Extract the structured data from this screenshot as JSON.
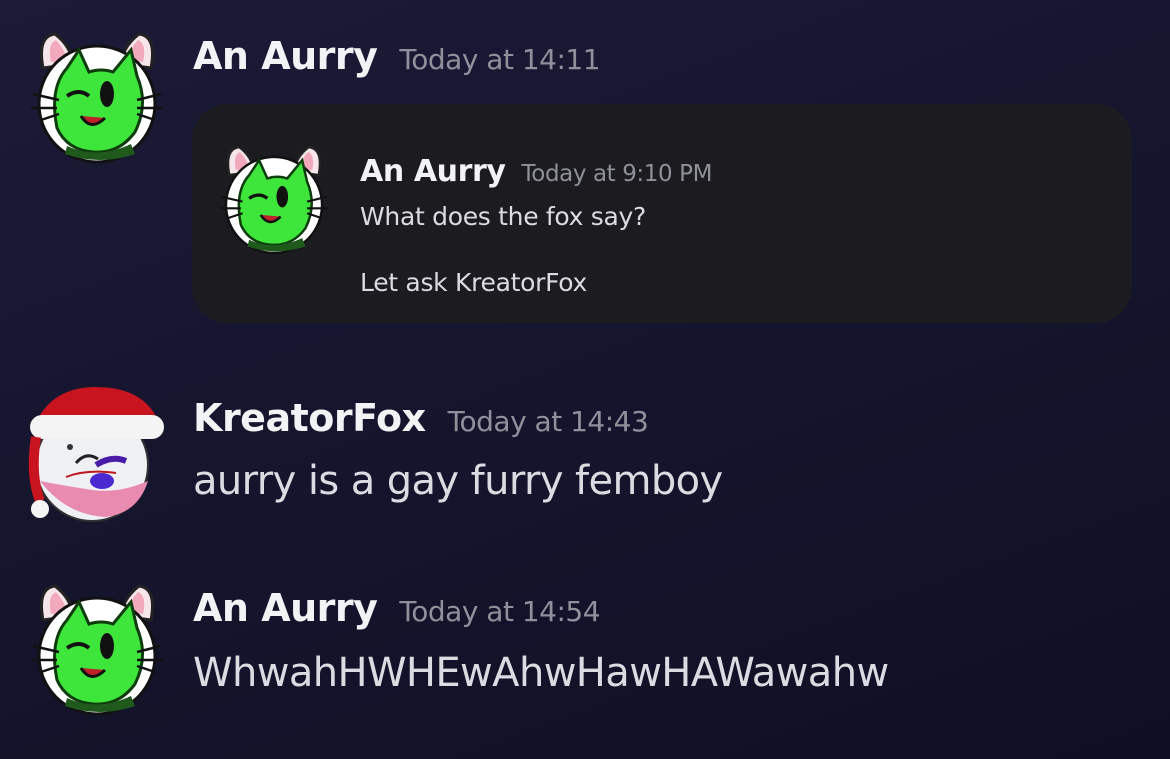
{
  "messages": [
    {
      "username": "An Aurry",
      "timestamp": "Today at 14:11",
      "forwarded": {
        "username": "An Aurry",
        "timestamp": "Today at 9:10 PM",
        "lines": [
          "What does the fox say?",
          "Let ask KreatorFox"
        ]
      }
    },
    {
      "username": "KreatorFox",
      "timestamp": "Today at 14:43",
      "content": "aurry is a gay furry femboy"
    },
    {
      "username": "An Aurry",
      "timestamp": "Today at 14:54",
      "content": "WhwahHWHEwAhwHawHAWawahw"
    }
  ],
  "colors": {
    "background_top": "#1b1b38",
    "background_bottom": "#0f0f24",
    "username": "#f2f3f5",
    "timestamp": "#8e909a",
    "message_text": "#dbdce2",
    "forward_card": "#1b1b20",
    "cat_green": "#3ee53a",
    "hat_red": "#c8141e"
  },
  "icons": {
    "aurry_avatar": "green-cat-avatar-icon",
    "kreator_avatar": "santa-hat-fox-avatar-icon"
  }
}
